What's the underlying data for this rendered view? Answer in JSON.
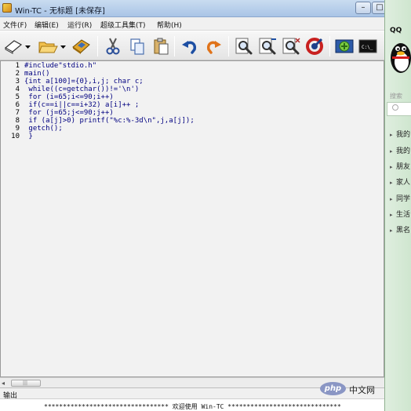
{
  "window": {
    "title": "Win-TC - 无标题 [未保存]",
    "minimize_glyph": "–",
    "maximize_glyph": "□"
  },
  "menu": [
    {
      "label": "文件(F)"
    },
    {
      "label": "编辑(E)"
    },
    {
      "label": "运行(R)"
    },
    {
      "label": "超级工具集(T)"
    },
    {
      "label": "帮助(H)"
    }
  ],
  "toolbar": {
    "buttons": [
      {
        "name": "new-file",
        "icon": "blank-page-icon"
      },
      {
        "name": "open-file",
        "icon": "folder-icon"
      },
      {
        "name": "save-file",
        "icon": "save-disk-icon"
      },
      {
        "name": "cut",
        "icon": "scissors-icon"
      },
      {
        "name": "copy",
        "icon": "copy-icon"
      },
      {
        "name": "paste",
        "icon": "paste-icon"
      },
      {
        "name": "undo",
        "icon": "undo-arrow-icon"
      },
      {
        "name": "redo",
        "icon": "redo-arrow-icon"
      },
      {
        "name": "find",
        "icon": "magnifier-icon"
      },
      {
        "name": "find-next",
        "icon": "magnifier-next-icon"
      },
      {
        "name": "replace",
        "icon": "magnifier-replace-icon"
      },
      {
        "name": "refresh",
        "icon": "refresh-icon"
      },
      {
        "name": "compile-run",
        "icon": "compile-run-icon"
      },
      {
        "name": "console",
        "icon": "console-icon"
      }
    ],
    "console_glyph": "C:\\_"
  },
  "editor": {
    "line_numbers": [
      "1",
      "2",
      "3",
      "4",
      "5",
      "6",
      "7",
      "8",
      "9",
      "10"
    ],
    "lines": [
      "#include\"stdio.h\"",
      "main()",
      "{int a[100]={0},i,j; char c;",
      " while((c=getchar())!='\\n')",
      " for (i=65;i<=90;i++)",
      " if(c==i||c==i+32) a[i]++ ;",
      " for (j=65;j<=90;j++)",
      " if (a[j]>0) printf(\"%c:%-3d\\n\",j,a[j]);",
      " getch();",
      " }"
    ]
  },
  "scrollbar": {
    "left_arrow": "◂",
    "grip": "|||"
  },
  "output": {
    "label": "输出",
    "message": "********************************* 欢迎使用 Win-TC ******************************"
  },
  "qq_panel": {
    "title": "QQ",
    "search_placeholder": "搜索",
    "items": [
      "我的",
      "我的",
      "朋友",
      "家人",
      "同学",
      "生活",
      "黑名"
    ],
    "arrow": "▸"
  },
  "watermark": {
    "logo_text": "php",
    "site_text": "中文网"
  },
  "colors": {
    "code_text": "#000080",
    "editor_background": "#f2f2f2",
    "qq_panel": "#d6ead6"
  }
}
